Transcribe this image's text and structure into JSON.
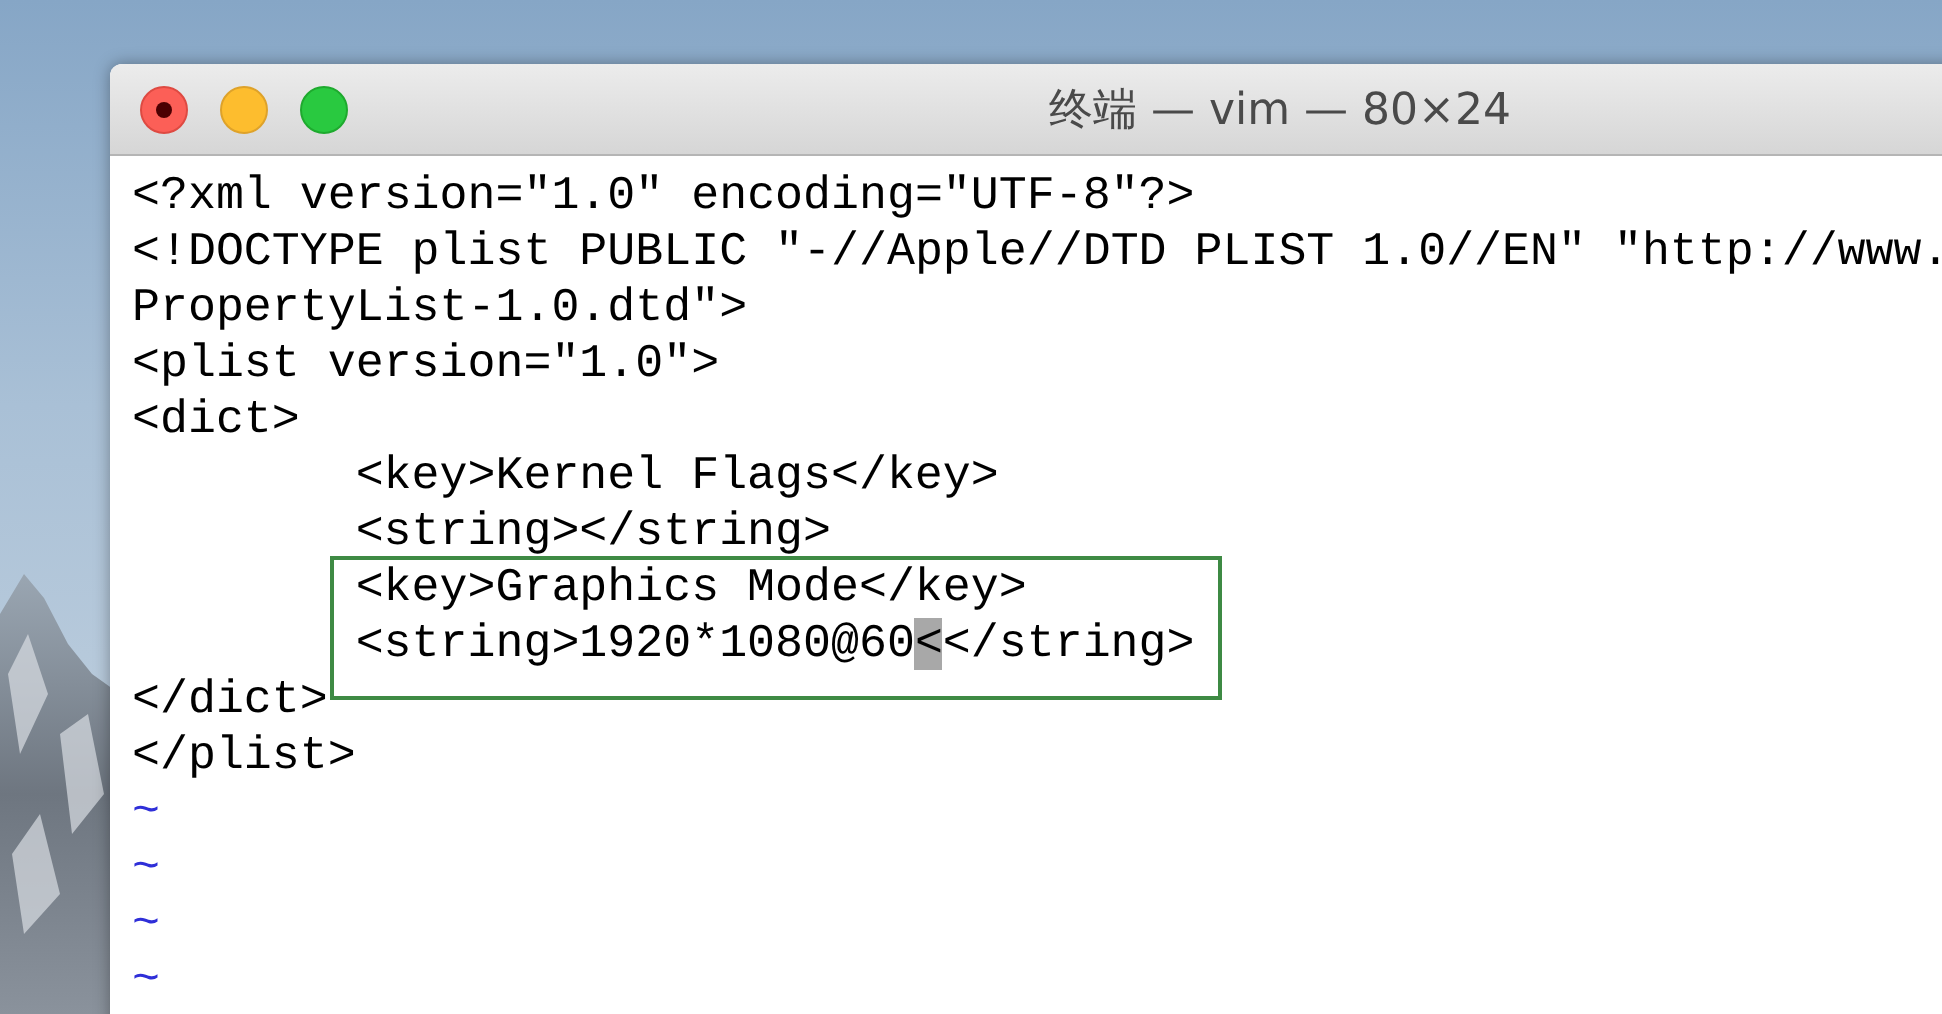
{
  "window": {
    "title": "终端 — vim — 80×24"
  },
  "editor": {
    "lines": [
      {
        "kind": "code",
        "text": "<?xml version=\"1.0\" encoding=\"UTF-8\"?>",
        "indented": false
      },
      {
        "kind": "code",
        "text": "<!DOCTYPE plist PUBLIC \"-//Apple//DTD PLIST 1.0//EN\" \"http://www.",
        "indented": false
      },
      {
        "kind": "code",
        "text": "PropertyList-1.0.dtd\">",
        "indented": false
      },
      {
        "kind": "code",
        "text": "<plist version=\"1.0\">",
        "indented": false
      },
      {
        "kind": "code",
        "text": "<dict>",
        "indented": false
      },
      {
        "kind": "code",
        "text": "<key>Kernel Flags</key>",
        "indented": true
      },
      {
        "kind": "code",
        "text": "<string></string>",
        "indented": true
      },
      {
        "kind": "highlight_box",
        "lines": [
          {
            "kind": "text",
            "text": "<key>Graphics Mode</key>"
          },
          {
            "kind": "cursor",
            "before": "<string>1920*1080@60",
            "char": "<",
            "after": "</string>"
          }
        ]
      },
      {
        "kind": "code",
        "text": "</dict>",
        "indented": false
      },
      {
        "kind": "code",
        "text": "</plist>",
        "indented": false
      },
      {
        "kind": "tilde",
        "text": "~"
      },
      {
        "kind": "tilde",
        "text": "~"
      },
      {
        "kind": "tilde",
        "text": "~"
      },
      {
        "kind": "tilde",
        "text": "~"
      }
    ]
  }
}
